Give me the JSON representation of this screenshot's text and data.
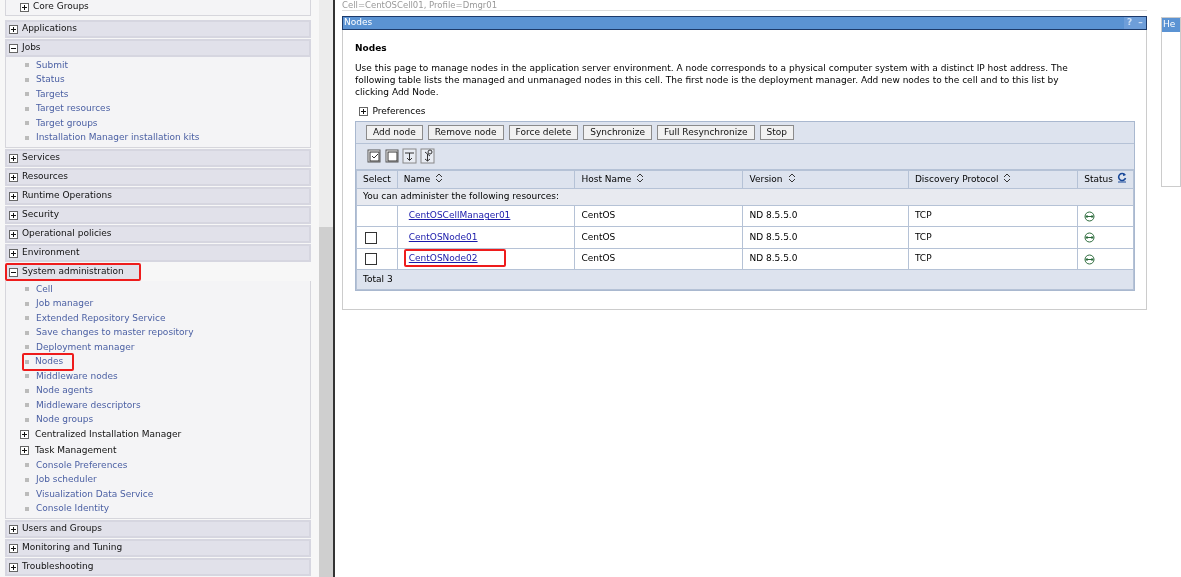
{
  "breadcrumb": "Cell=CentOSCell01, Profile=Dmgr01",
  "sidebar": {
    "top_items": [
      {
        "label": "Core Groups",
        "expanded": false
      }
    ],
    "sections": [
      {
        "label": "Applications",
        "expanded": false,
        "highlighted": false
      },
      {
        "label": "Jobs",
        "expanded": true,
        "highlighted": false,
        "items": [
          {
            "label": "Submit",
            "kind": "link",
            "highlighted": false
          },
          {
            "label": "Status",
            "kind": "link",
            "highlighted": false
          },
          {
            "label": "Targets",
            "kind": "link",
            "highlighted": false
          },
          {
            "label": "Target resources",
            "kind": "link",
            "highlighted": false
          },
          {
            "label": "Target groups",
            "kind": "link",
            "highlighted": false
          },
          {
            "label": "Installation Manager installation kits",
            "kind": "link",
            "highlighted": false
          }
        ]
      },
      {
        "label": "Services",
        "expanded": false,
        "highlighted": false
      },
      {
        "label": "Resources",
        "expanded": false,
        "highlighted": false
      },
      {
        "label": "Runtime Operations",
        "expanded": false,
        "highlighted": false
      },
      {
        "label": "Security",
        "expanded": false,
        "highlighted": false
      },
      {
        "label": "Operational policies",
        "expanded": false,
        "highlighted": false
      },
      {
        "label": "Environment",
        "expanded": false,
        "highlighted": false
      },
      {
        "label": "System administration",
        "expanded": true,
        "highlighted": true,
        "items": [
          {
            "label": "Cell",
            "kind": "link",
            "highlighted": false
          },
          {
            "label": "Job manager",
            "kind": "link",
            "highlighted": false
          },
          {
            "label": "Extended Repository Service",
            "kind": "link",
            "highlighted": false
          },
          {
            "label": "Save changes to master repository",
            "kind": "link",
            "highlighted": false
          },
          {
            "label": "Deployment manager",
            "kind": "link",
            "highlighted": false
          },
          {
            "label": "Nodes",
            "kind": "link",
            "highlighted": true
          },
          {
            "label": "Middleware nodes",
            "kind": "link",
            "highlighted": false
          },
          {
            "label": "Node agents",
            "kind": "link",
            "highlighted": false
          },
          {
            "label": "Middleware descriptors",
            "kind": "link",
            "highlighted": false
          },
          {
            "label": "Node groups",
            "kind": "link",
            "highlighted": false
          },
          {
            "label": "Centralized Installation Manager",
            "kind": "group",
            "highlighted": false
          },
          {
            "label": "Task Management",
            "kind": "group",
            "highlighted": false
          },
          {
            "label": "Console Preferences",
            "kind": "link",
            "highlighted": false
          },
          {
            "label": "Job scheduler",
            "kind": "link",
            "highlighted": false
          },
          {
            "label": "Visualization Data Service",
            "kind": "link",
            "highlighted": false
          },
          {
            "label": "Console Identity",
            "kind": "link",
            "highlighted": false
          }
        ]
      },
      {
        "label": "Users and Groups",
        "expanded": false,
        "highlighted": false
      },
      {
        "label": "Monitoring and Tuning",
        "expanded": false,
        "highlighted": false
      },
      {
        "label": "Troubleshooting",
        "expanded": false,
        "highlighted": false
      }
    ]
  },
  "panel": {
    "title": "Nodes",
    "help": "?",
    "minimize": "–",
    "heading": "Nodes",
    "description": "Use this page to manage nodes in the application server environment. A node corresponds to a physical computer system with a distinct IP host address. The following table lists the managed and unmanaged nodes in this cell. The first node is the deployment manager. Add new nodes to the cell and to this list by clicking Add Node.",
    "preferences": {
      "label": "Preferences",
      "expanded": false
    },
    "buttons": [
      "Add node",
      "Remove node",
      "Force delete",
      "Synchronize",
      "Full Resynchronize",
      "Stop"
    ],
    "table": {
      "columns": [
        "Select",
        "Name",
        "Host Name",
        "Version",
        "Discovery Protocol",
        "Status"
      ],
      "caption": "You can administer the following resources:",
      "rows": [
        {
          "name": "CentOSCellManager01",
          "host": "CentOS",
          "version": "ND 8.5.5.0",
          "protocol": "TCP",
          "selectable": false,
          "highlighted": false
        },
        {
          "name": "CentOSNode01",
          "host": "CentOS",
          "version": "ND 8.5.5.0",
          "protocol": "TCP",
          "selectable": true,
          "checked": false,
          "highlighted": false
        },
        {
          "name": "CentOSNode02",
          "host": "CentOS",
          "version": "ND 8.5.5.0",
          "protocol": "TCP",
          "selectable": true,
          "checked": false,
          "highlighted": true
        }
      ],
      "total": "Total 3"
    }
  },
  "help_panel": {
    "title": "He"
  }
}
